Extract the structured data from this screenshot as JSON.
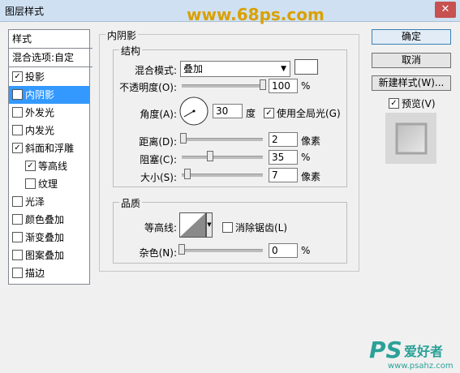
{
  "window": {
    "title": "图层样式",
    "close_label": "✕"
  },
  "watermark": "www.68ps.com",
  "styles_list": {
    "header": "样式",
    "blend_options": "混合选项:自定",
    "items": [
      {
        "label": "投影",
        "checked": true
      },
      {
        "label": "内阴影",
        "checked": true,
        "selected": true
      },
      {
        "label": "外发光",
        "checked": false
      },
      {
        "label": "内发光",
        "checked": false
      },
      {
        "label": "斜面和浮雕",
        "checked": true
      },
      {
        "label": "等高线",
        "checked": true,
        "sub": true
      },
      {
        "label": "纹理",
        "checked": false,
        "sub": true
      },
      {
        "label": "光泽",
        "checked": false
      },
      {
        "label": "颜色叠加",
        "checked": false
      },
      {
        "label": "渐变叠加",
        "checked": false
      },
      {
        "label": "图案叠加",
        "checked": false
      },
      {
        "label": "描边",
        "checked": false
      }
    ]
  },
  "inner_shadow": {
    "title": "内阴影",
    "structure": {
      "title": "结构",
      "blend_mode_label": "混合模式:",
      "blend_mode_value": "叠加",
      "opacity_label": "不透明度(O):",
      "opacity_value": "100",
      "opacity_unit": "%",
      "opacity_fraction": 1.0,
      "angle_label": "角度(A):",
      "angle_value": "30",
      "angle_unit": "度",
      "global_light_label": "使用全局光(G)",
      "global_light_checked": true,
      "distance_label": "距离(D):",
      "distance_value": "2",
      "distance_unit": "像素",
      "distance_fraction": 0.02,
      "choke_label": "阻塞(C):",
      "choke_value": "35",
      "choke_unit": "%",
      "choke_fraction": 0.35,
      "size_label": "大小(S):",
      "size_value": "7",
      "size_unit": "像素",
      "size_fraction": 0.07
    },
    "quality": {
      "title": "品质",
      "contour_label": "等高线:",
      "antialias_label": "消除锯齿(L)",
      "antialias_checked": false,
      "noise_label": "杂色(N):",
      "noise_value": "0",
      "noise_unit": "%",
      "noise_fraction": 0.0
    }
  },
  "buttons": {
    "ok": "确定",
    "cancel": "取消",
    "new_style": "新建样式(W)...",
    "preview_label": "预览(V)",
    "preview_checked": true
  },
  "branding": {
    "logo": "PS",
    "logo_cn": "爱好者",
    "url": "www.psahz.com"
  },
  "colors": {
    "selection": "#3399ff",
    "titlebar": "#cfe0f2",
    "watermark": "#d9a100",
    "logo": "#2aa198"
  }
}
